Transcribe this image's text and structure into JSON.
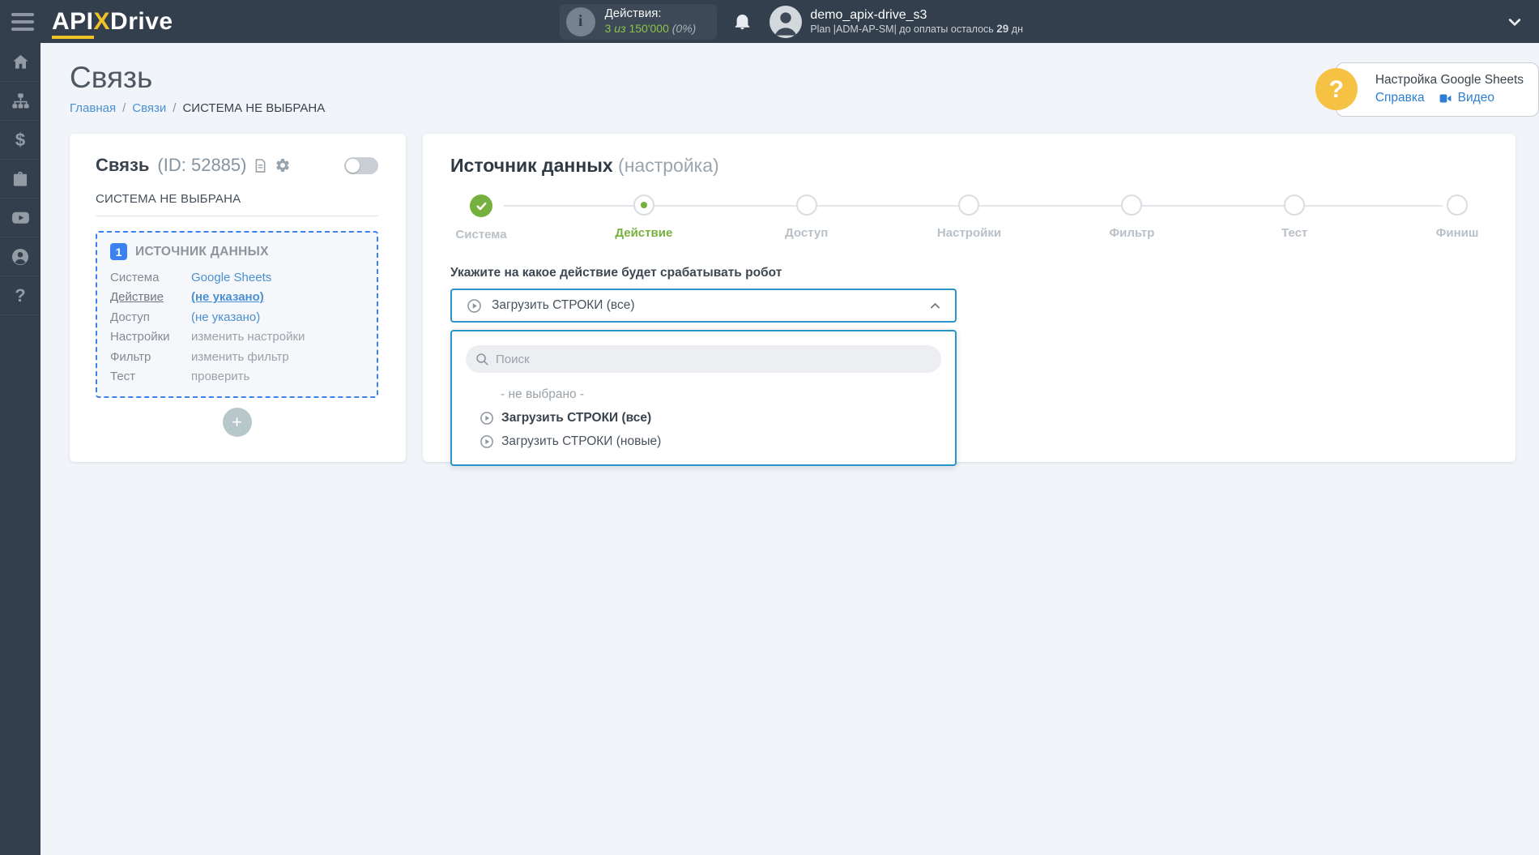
{
  "header": {
    "logo": {
      "part1": "API",
      "part2": "X",
      "part3": "Drive"
    },
    "actions_counter": {
      "label": "Действия:",
      "used": "3",
      "preposition": "из",
      "total": "150'000",
      "percent": "(0%)"
    },
    "user": {
      "name": "demo_apix-drive_s3",
      "plan_prefix": "Plan  |ADM-AP-SM|  до оплаты осталось",
      "days": "29",
      "days_suffix": "дн"
    }
  },
  "sidebar": {
    "icons": [
      "home",
      "connections",
      "billing",
      "services",
      "video",
      "account",
      "help"
    ],
    "help_glyph": "?",
    "billing_glyph": "$"
  },
  "page": {
    "title": "Связь",
    "breadcrumb": {
      "home": "Главная",
      "links": "Связи",
      "current": "СИСТЕМА НЕ ВЫБРАНА",
      "separator": "/"
    }
  },
  "help_card": {
    "title": "Настройка Google Sheets",
    "link_help": "Справка",
    "link_video": "Видео",
    "question_glyph": "?"
  },
  "link_card": {
    "title": "Связь",
    "id_text": "(ID: 52885)",
    "subtitle": "СИСТЕМА НЕ ВЫБРАНА",
    "source_box": {
      "badge": "1",
      "title": "ИСТОЧНИК ДАННЫХ",
      "rows": [
        {
          "label": "Система",
          "value": "Google Sheets"
        },
        {
          "label": "Действие",
          "value": "(не указано)"
        },
        {
          "label": "Доступ",
          "value": "(не указано)"
        },
        {
          "label": "Настройки",
          "value": "изменить настройки"
        },
        {
          "label": "Фильтр",
          "value": "изменить фильтр"
        },
        {
          "label": "Тест",
          "value": "проверить"
        }
      ]
    },
    "add_button_glyph": "+"
  },
  "source_panel": {
    "title": "Источник данных",
    "title_suffix": "(настройка)",
    "steps": [
      {
        "label": "Система",
        "state": "done"
      },
      {
        "label": "Действие",
        "state": "active"
      },
      {
        "label": "Доступ",
        "state": "pending"
      },
      {
        "label": "Настройки",
        "state": "pending"
      },
      {
        "label": "Фильтр",
        "state": "pending"
      },
      {
        "label": "Тест",
        "state": "pending"
      },
      {
        "label": "Финиш",
        "state": "pending"
      }
    ],
    "question": "Укажите на какое действие будет срабатывать робот",
    "select": {
      "value": "Загрузить СТРОКИ (все)"
    },
    "dropdown": {
      "search_placeholder": "Поиск",
      "options": [
        {
          "label": "- не выбрано -"
        },
        {
          "label": "Загрузить СТРОКИ (все)"
        },
        {
          "label": "Загрузить СТРОКИ (новые)"
        }
      ]
    }
  },
  "colors": {
    "header_bg": "#333f4d",
    "accent_green": "#8bc34a",
    "step_green": "#76b13f",
    "link_blue": "#4a90d2",
    "bright_blue": "#3b82f0",
    "select_border": "#2795c9",
    "brand_yellow": "#f0c228"
  }
}
